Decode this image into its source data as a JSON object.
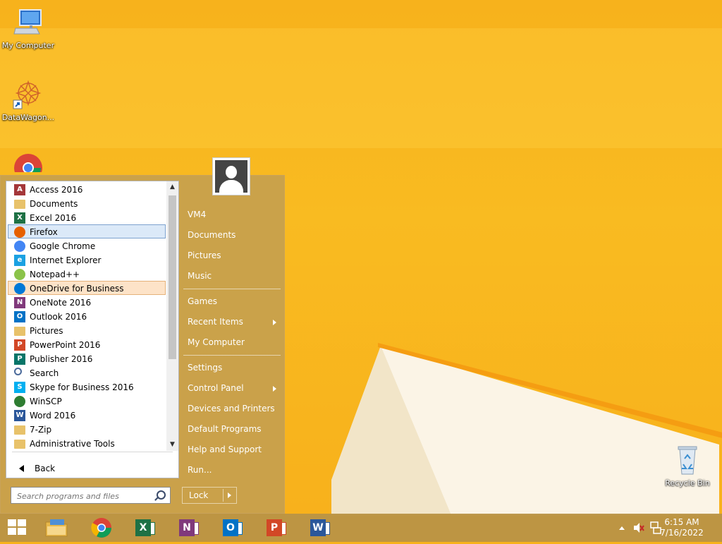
{
  "desktop": {
    "icons": [
      {
        "label": "My Computer"
      },
      {
        "label": "DataWagon..."
      },
      {
        "label": "Recycle Bin"
      }
    ]
  },
  "start_menu": {
    "programs": [
      {
        "label": "Access 2016",
        "icon": "access-icon",
        "color": "#a4373a",
        "letter": "A"
      },
      {
        "label": "Documents",
        "icon": "folder-icon",
        "color": "#e8c26a",
        "letter": ""
      },
      {
        "label": "Excel 2016",
        "icon": "excel-icon",
        "color": "#1e7145",
        "letter": "X"
      },
      {
        "label": "Firefox",
        "icon": "firefox-icon",
        "color": "#e66000",
        "letter": ""
      },
      {
        "label": "Google Chrome",
        "icon": "chrome-icon",
        "color": "#4285f4",
        "letter": ""
      },
      {
        "label": "Internet Explorer",
        "icon": "ie-icon",
        "color": "#1ba1e2",
        "letter": "e"
      },
      {
        "label": "Notepad++",
        "icon": "notepad-icon",
        "color": "#8bc34a",
        "letter": ""
      },
      {
        "label": "OneDrive for Business",
        "icon": "onedrive-icon",
        "color": "#0078d7",
        "letter": ""
      },
      {
        "label": "OneNote 2016",
        "icon": "onenote-icon",
        "color": "#80397b",
        "letter": "N"
      },
      {
        "label": "Outlook 2016",
        "icon": "outlook-icon",
        "color": "#0072c6",
        "letter": "O"
      },
      {
        "label": "Pictures",
        "icon": "folder-icon",
        "color": "#e8c26a",
        "letter": ""
      },
      {
        "label": "PowerPoint 2016",
        "icon": "powerpoint-icon",
        "color": "#d24726",
        "letter": "P"
      },
      {
        "label": "Publisher 2016",
        "icon": "publisher-icon",
        "color": "#077568",
        "letter": "P"
      },
      {
        "label": "Search",
        "icon": "search-icon",
        "color": "#4a6a9a",
        "letter": ""
      },
      {
        "label": "Skype for Business 2016",
        "icon": "skype-icon",
        "color": "#00aff0",
        "letter": "S"
      },
      {
        "label": "WinSCP",
        "icon": "winscp-icon",
        "color": "#2e7d32",
        "letter": ""
      },
      {
        "label": "Word 2016",
        "icon": "word-icon",
        "color": "#2b579a",
        "letter": "W"
      },
      {
        "label": "7-Zip",
        "icon": "folder-icon",
        "color": "#e8c26a",
        "letter": ""
      },
      {
        "label": "Administrative Tools",
        "icon": "folder-icon",
        "color": "#e8c26a",
        "letter": ""
      }
    ],
    "selected_program": "Firefox",
    "highlighted_program": "OneDrive for Business",
    "back_label": "Back",
    "search": {
      "placeholder": "Search programs and files",
      "value": ""
    },
    "right_items": [
      {
        "label": "VM4",
        "submenu": false
      },
      {
        "label": "Documents",
        "submenu": false
      },
      {
        "label": "Pictures",
        "submenu": false
      },
      {
        "label": "Music",
        "submenu": false
      },
      {
        "label": "Games",
        "submenu": false
      },
      {
        "label": "Recent Items",
        "submenu": true
      },
      {
        "label": "My Computer",
        "submenu": false
      },
      {
        "label": "Settings",
        "submenu": false
      },
      {
        "label": "Control Panel",
        "submenu": true
      },
      {
        "label": "Devices and Printers",
        "submenu": false
      },
      {
        "label": "Default Programs",
        "submenu": false
      },
      {
        "label": "Help and Support",
        "submenu": false
      },
      {
        "label": "Run...",
        "submenu": false
      }
    ],
    "lock_label": "Lock"
  },
  "taskbar": {
    "pinned": [
      {
        "name": "file-explorer-icon"
      },
      {
        "name": "chrome-icon"
      },
      {
        "name": "excel-icon",
        "letter": "X",
        "color": "#1e7145"
      },
      {
        "name": "onenote-icon",
        "letter": "N",
        "color": "#80397b"
      },
      {
        "name": "outlook-icon",
        "letter": "O",
        "color": "#0072c6"
      },
      {
        "name": "powerpoint-icon",
        "letter": "P",
        "color": "#d24726"
      },
      {
        "name": "word-icon",
        "letter": "W",
        "color": "#2b579a"
      }
    ],
    "time": "6:15 AM",
    "date": "7/16/2022"
  }
}
